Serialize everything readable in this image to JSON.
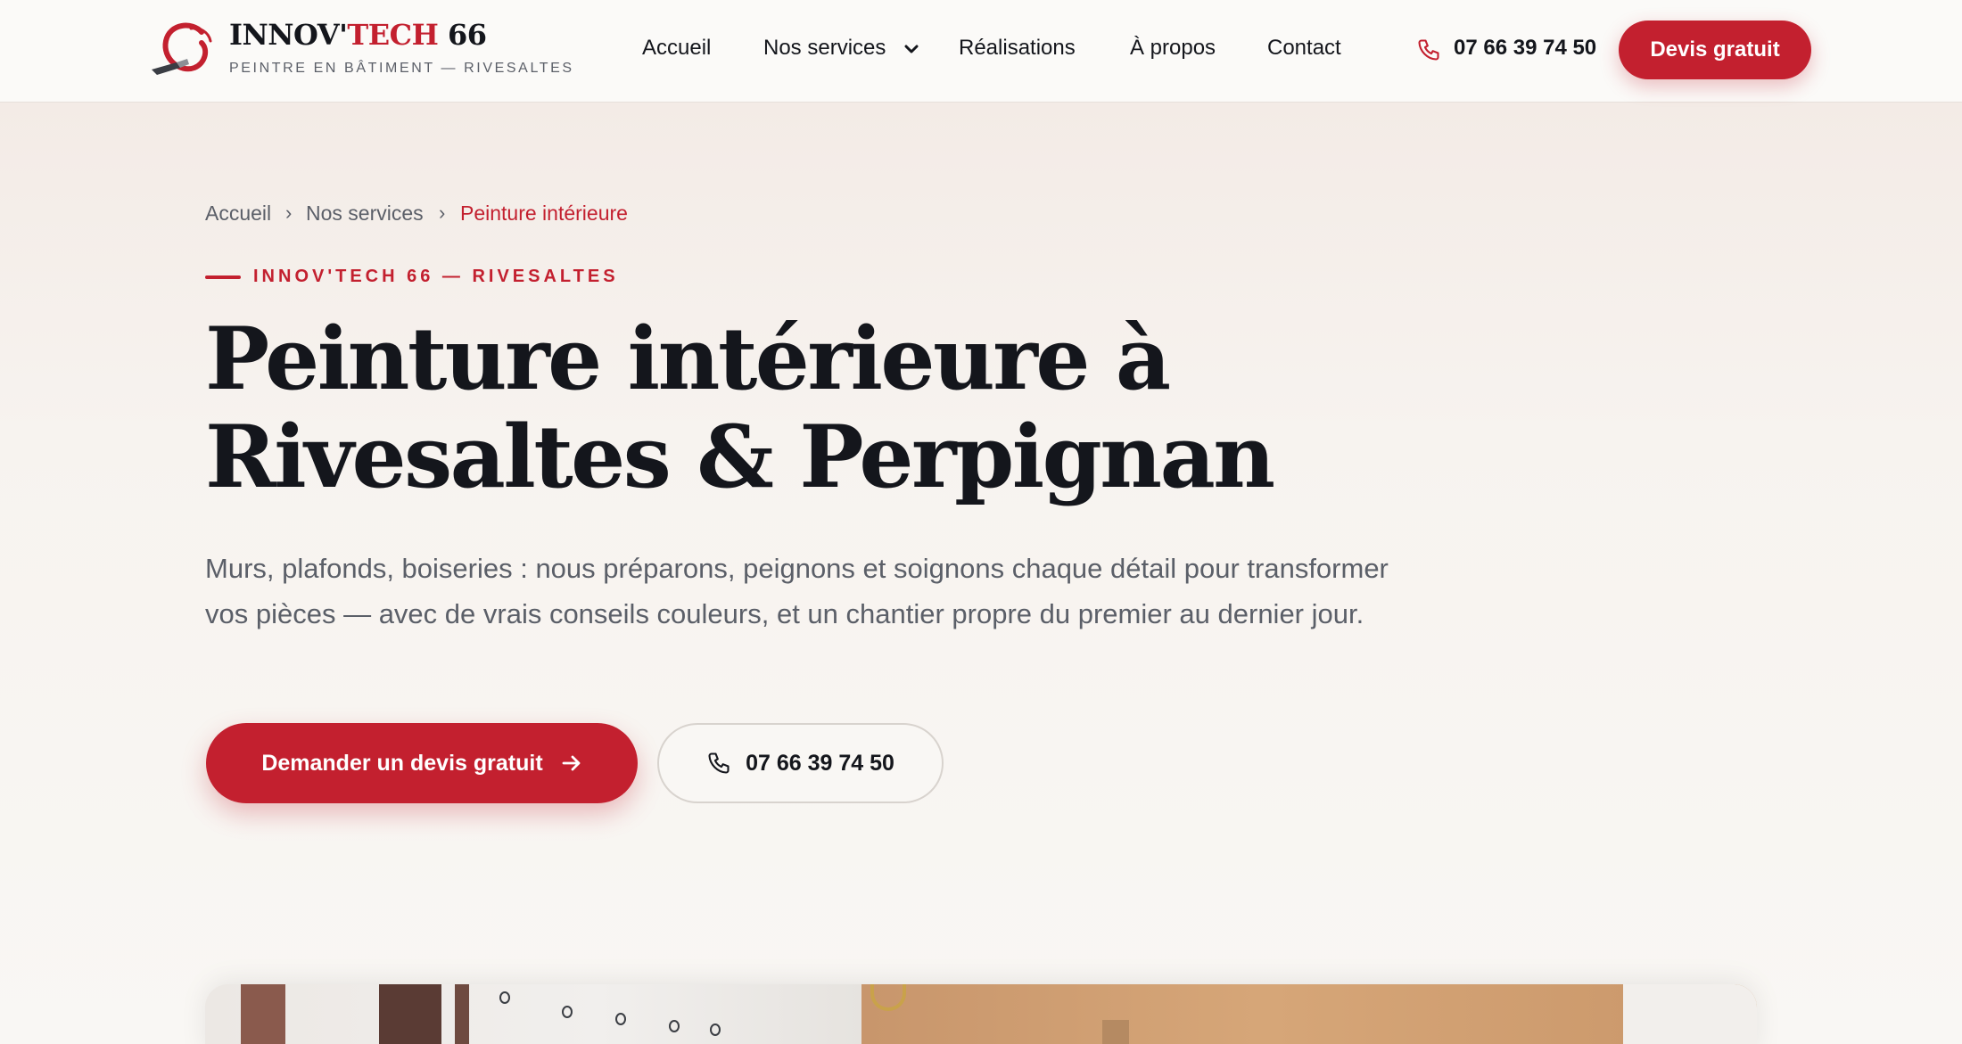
{
  "header": {
    "logo": {
      "name_part1": "INNOV'",
      "name_part2": "TECH",
      "name_part3": " 66",
      "tagline": "PEINTRE EN BÂTIMENT — RIVESALTES"
    },
    "nav": [
      {
        "label": "Accueil"
      },
      {
        "label": "Nos services",
        "has_dropdown": true
      },
      {
        "label": "Réalisations"
      },
      {
        "label": "À propos"
      },
      {
        "label": "Contact"
      }
    ],
    "phone": "07 66 39 74 50",
    "cta_label": "Devis gratuit"
  },
  "breadcrumb": {
    "items": [
      "Accueil",
      "Nos services",
      "Peinture intérieure"
    ],
    "separator": "›"
  },
  "hero": {
    "eyebrow": "INNOV'TECH 66 — RIVESALTES",
    "title_line1": "Peinture intérieure à",
    "title_line2": "Rivesaltes & Perpignan",
    "description": "Murs, plafonds, boiseries : nous préparons, peignons et soignons chaque détail pour transformer vos pièces — avec de vrais conseils couleurs, et un chantier propre du premier au dernier jour.",
    "cta_primary": "Demander un devis gratuit",
    "cta_secondary": "07 66 39 74 50"
  },
  "colors": {
    "accent": "#c3202f",
    "text_dark": "#14161c",
    "text_muted": "#5b5f68",
    "background": "#f8f5f1"
  },
  "icons": {
    "logo": "brush-swirl-logo-icon",
    "dropdown": "chevron-down-icon",
    "phone": "phone-icon",
    "arrow": "arrow-right-icon"
  }
}
